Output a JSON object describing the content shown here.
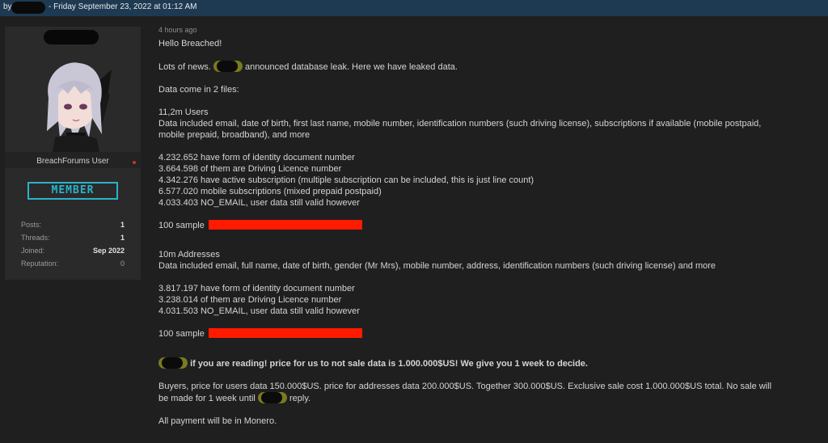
{
  "header": {
    "by": "by",
    "date": "- Friday September 23, 2022 at 01:12 AM"
  },
  "user": {
    "title": "BreachForums User",
    "rank": "MEMBER",
    "stats": [
      {
        "key": "Posts:",
        "value": "1"
      },
      {
        "key": "Threads:",
        "value": "1"
      },
      {
        "key": "Joined:",
        "value": "Sep 2022"
      },
      {
        "key": "Reputation:",
        "value": "0"
      }
    ]
  },
  "post": {
    "time_ago": "4 hours ago",
    "greeting": "Hello Breached!",
    "news_prefix": "Lots of news.",
    "news_suffix": "announced database leak. Here we have leaked data.",
    "files_intro": "Data come in 2 files:",
    "users_heading": "11,2m Users",
    "users_desc_1": "Data included email, date of birth, first last name, mobile number, identification numbers (such driving license), subscriptions if available (mobile postpaid,",
    "users_desc_2": "mobile prepaid, broadband), and more",
    "users_stats": [
      "4.232.652 have form of identity document number",
      "3.664.598 of them are Driving Licence number",
      "4.342.276 have active subscription (multiple subscription can be included, this is just line count)",
      "6.577.020 mobile subscriptions (mixed prepaid postpaid)",
      "4.033.403 NO_EMAIL, user data still valid however"
    ],
    "sample_label": "100 sample",
    "addresses_heading": "10m Addresses",
    "addresses_desc": "Data included email, full name, date of birth, gender (Mr Mrs), mobile number, address, identification numbers (such driving license) and more",
    "addresses_stats": [
      "3.817.197 have form of identity document number",
      "3.238.014 of them are Driving Licence number",
      "4.031.503 NO_EMAIL, user data still valid however"
    ],
    "ransom": "if you are reading! price for us to not sale data is 1.000.000$US! We give you 1 week to decide.",
    "buyers_1": "Buyers, price for users data 150.000$US. price for addresses data 200.000$US. Together 300.000$US. Exclusive sale cost 1.000.000$US total. No sale will",
    "buyers_2_prefix": "be made for 1 week until",
    "buyers_2_suffix": "reply.",
    "payment": "All payment will be in Monero."
  }
}
